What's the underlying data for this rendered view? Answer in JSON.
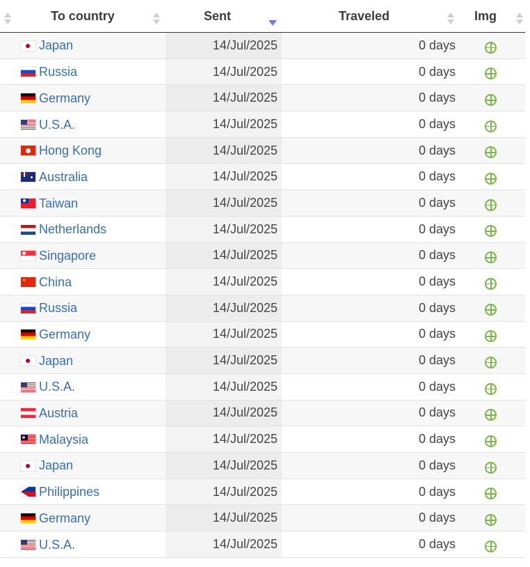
{
  "headers": {
    "country": "To country",
    "sent": "Sent",
    "traveled": "Traveled",
    "img": "Img"
  },
  "colors": {
    "link": "#3a6fb0",
    "plus_icon": "#7ab648",
    "active_sort_arrow": "#6f7cf0"
  },
  "rows": [
    {
      "flag": "jp",
      "country": "Japan",
      "sent": "14/Jul/2025",
      "traveled": "0 days",
      "img_icon": "add-circle-icon"
    },
    {
      "flag": "ru",
      "country": "Russia",
      "sent": "14/Jul/2025",
      "traveled": "0 days",
      "img_icon": "add-circle-icon"
    },
    {
      "flag": "de",
      "country": "Germany",
      "sent": "14/Jul/2025",
      "traveled": "0 days",
      "img_icon": "add-circle-icon"
    },
    {
      "flag": "us",
      "country": "U.S.A.",
      "sent": "14/Jul/2025",
      "traveled": "0 days",
      "img_icon": "add-circle-icon"
    },
    {
      "flag": "hk",
      "country": "Hong Kong",
      "sent": "14/Jul/2025",
      "traveled": "0 days",
      "img_icon": "add-circle-icon"
    },
    {
      "flag": "au",
      "country": "Australia",
      "sent": "14/Jul/2025",
      "traveled": "0 days",
      "img_icon": "add-circle-icon"
    },
    {
      "flag": "tw",
      "country": "Taiwan",
      "sent": "14/Jul/2025",
      "traveled": "0 days",
      "img_icon": "add-circle-icon"
    },
    {
      "flag": "nl",
      "country": "Netherlands",
      "sent": "14/Jul/2025",
      "traveled": "0 days",
      "img_icon": "add-circle-icon"
    },
    {
      "flag": "sg",
      "country": "Singapore",
      "sent": "14/Jul/2025",
      "traveled": "0 days",
      "img_icon": "add-circle-icon"
    },
    {
      "flag": "cn",
      "country": "China",
      "sent": "14/Jul/2025",
      "traveled": "0 days",
      "img_icon": "add-circle-icon"
    },
    {
      "flag": "ru",
      "country": "Russia",
      "sent": "14/Jul/2025",
      "traveled": "0 days",
      "img_icon": "add-circle-icon"
    },
    {
      "flag": "de",
      "country": "Germany",
      "sent": "14/Jul/2025",
      "traveled": "0 days",
      "img_icon": "add-circle-icon"
    },
    {
      "flag": "jp",
      "country": "Japan",
      "sent": "14/Jul/2025",
      "traveled": "0 days",
      "img_icon": "add-circle-icon"
    },
    {
      "flag": "us",
      "country": "U.S.A.",
      "sent": "14/Jul/2025",
      "traveled": "0 days",
      "img_icon": "add-circle-icon"
    },
    {
      "flag": "at",
      "country": "Austria",
      "sent": "14/Jul/2025",
      "traveled": "0 days",
      "img_icon": "add-circle-icon"
    },
    {
      "flag": "my",
      "country": "Malaysia",
      "sent": "14/Jul/2025",
      "traveled": "0 days",
      "img_icon": "add-circle-icon"
    },
    {
      "flag": "jp",
      "country": "Japan",
      "sent": "14/Jul/2025",
      "traveled": "0 days",
      "img_icon": "add-circle-icon"
    },
    {
      "flag": "ph",
      "country": "Philippines",
      "sent": "14/Jul/2025",
      "traveled": "0 days",
      "img_icon": "add-circle-icon"
    },
    {
      "flag": "de",
      "country": "Germany",
      "sent": "14/Jul/2025",
      "traveled": "0 days",
      "img_icon": "add-circle-icon"
    },
    {
      "flag": "us",
      "country": "U.S.A.",
      "sent": "14/Jul/2025",
      "traveled": "0 days",
      "img_icon": "add-circle-icon"
    }
  ]
}
